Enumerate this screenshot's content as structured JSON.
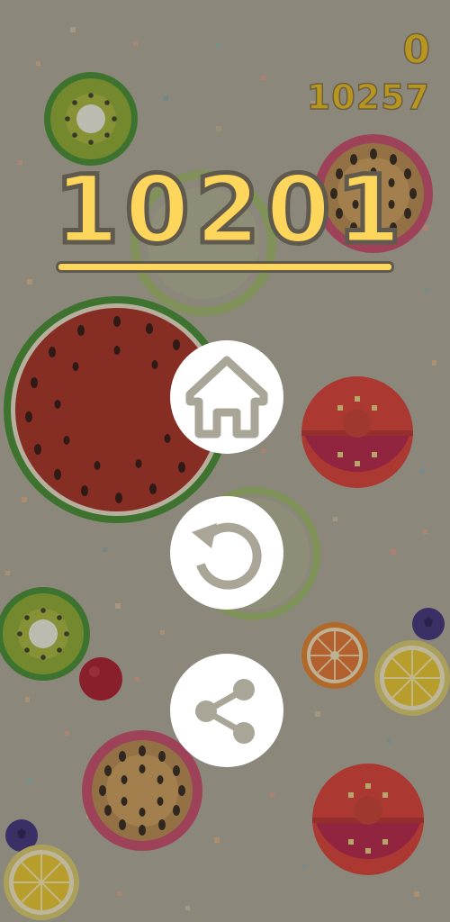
{
  "hud": {
    "current_score": "0",
    "best_score": "10257"
  },
  "game_over": {
    "final_score": "10201"
  },
  "buttons": {
    "home": {
      "icon": "home-icon"
    },
    "restart": {
      "icon": "restart-icon"
    },
    "share": {
      "icon": "share-icon"
    }
  },
  "colors": {
    "background": "#a9a597",
    "score_fill": "#ffd65c",
    "button_fill": "#ffffff",
    "icon_color": "#a9a597"
  }
}
